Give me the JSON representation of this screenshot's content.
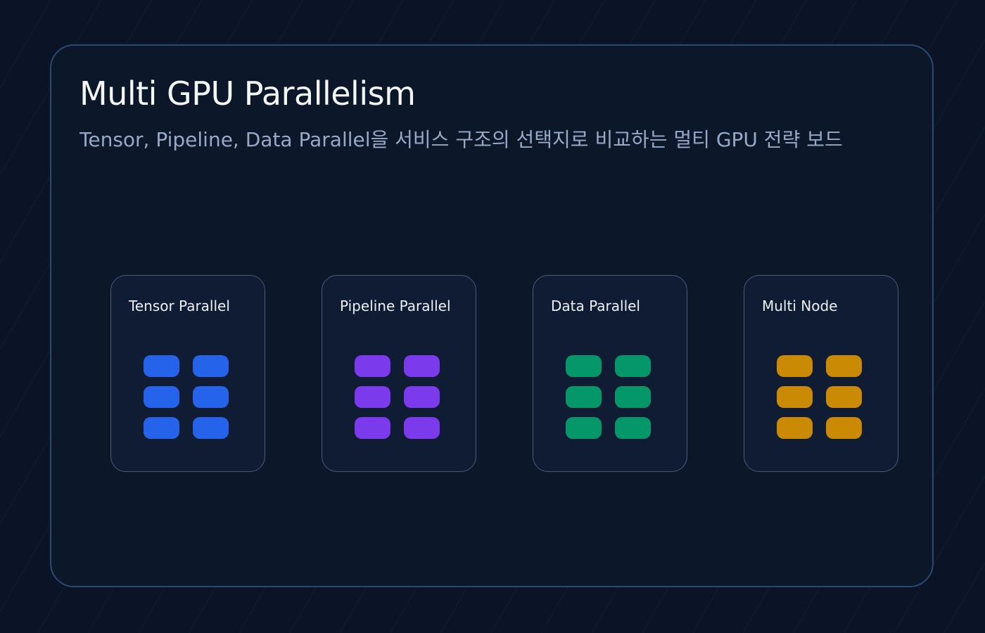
{
  "board": {
    "title": "Multi GPU Parallelism",
    "subtitle": "Tensor, Pipeline, Data Parallel을 서비스 구조의 선택지로 비교하는 멀티 GPU 전략 보드"
  },
  "strategies": [
    {
      "label": "Tensor Parallel",
      "color": "#2563eb",
      "gpu_count": 6
    },
    {
      "label": "Pipeline Parallel",
      "color": "#7c3aed",
      "gpu_count": 6
    },
    {
      "label": "Data Parallel",
      "color": "#059669",
      "gpu_count": 6
    },
    {
      "label": "Multi Node",
      "color": "#ca8a04",
      "gpu_count": 6
    }
  ]
}
